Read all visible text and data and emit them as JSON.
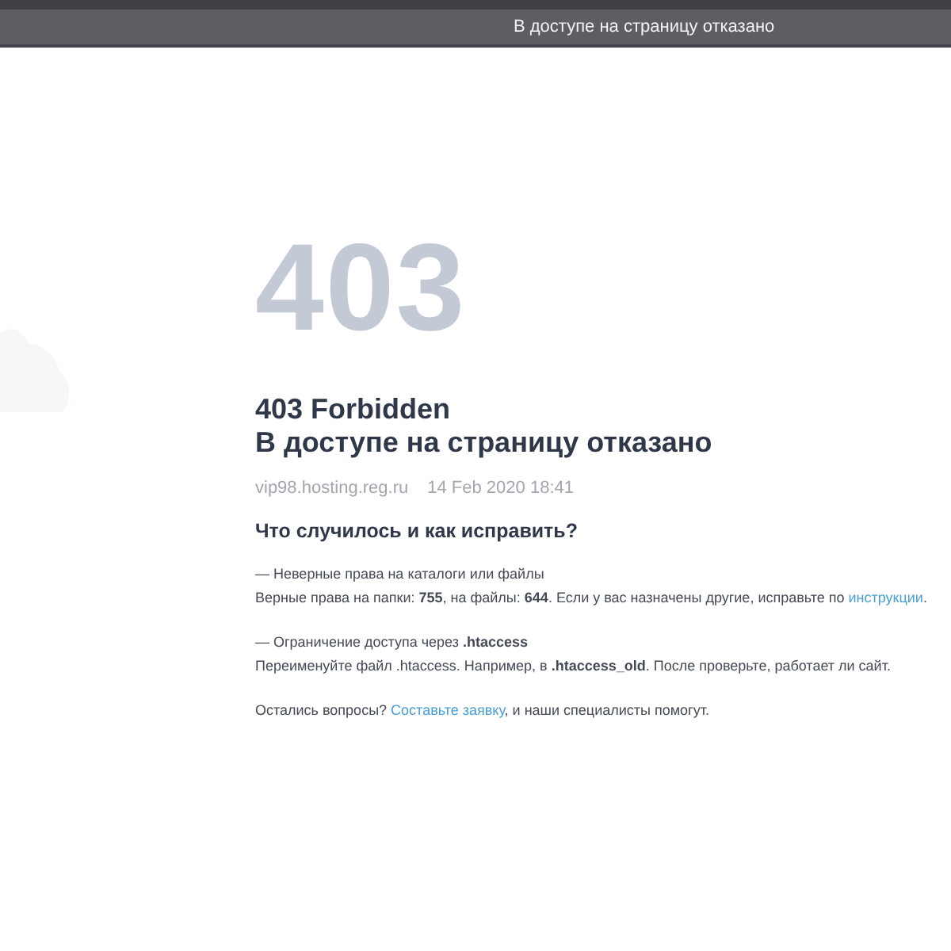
{
  "window": {
    "title": "В доступе на страницу отказано"
  },
  "code": "403",
  "heading": [
    "403 Forbidden",
    "В доступе на страницу отказано"
  ],
  "meta": {
    "host": "vip98.hosting.reg.ru",
    "date": "14 Feb 2020 18:41"
  },
  "subheading": "Что случилось и как исправить?",
  "causes": [
    {
      "title": "— Неверные права на каталоги или файлы",
      "text": "Верные права на папки: **755**, на файлы: **644**. Если у вас назначены другие, исправьте по ",
      "link": "инструкции",
      "after": "."
    },
    {
      "title": "— Ограничение доступа через **.htaccess**",
      "text": "Переименуйте файл .htaccess. Например, в **.htaccess_old**. После проверьте, работает ли сайт."
    }
  ],
  "footer": {
    "text": "Остались вопросы? ",
    "link": "Составьте заявку",
    "after": ", и наши специалисты помогут."
  }
}
